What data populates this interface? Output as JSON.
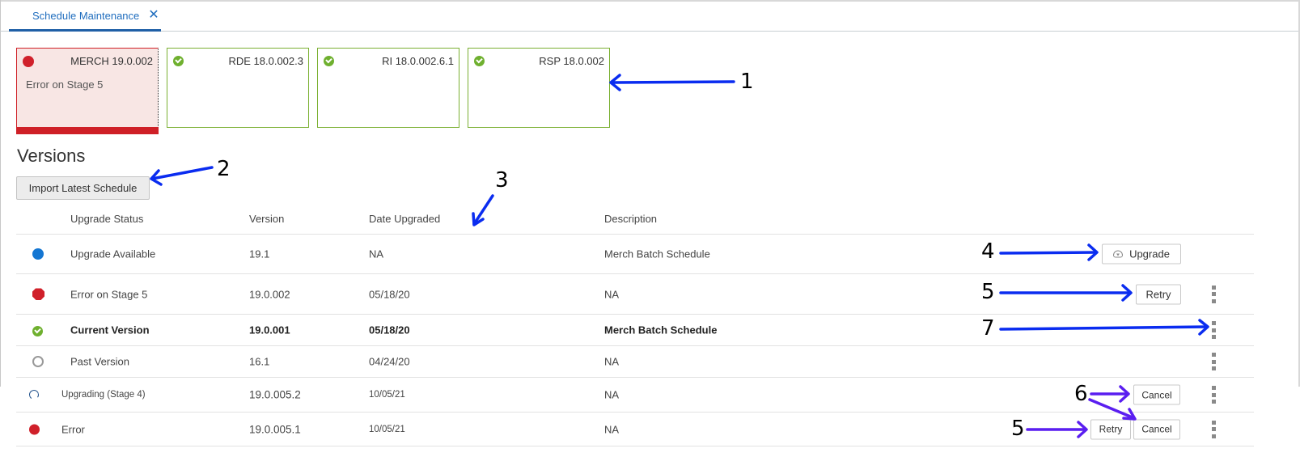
{
  "tab": {
    "label": "Schedule Maintenance",
    "close_icon": "close-icon"
  },
  "cards": [
    {
      "title": "MERCH 19.0.002",
      "status": "error",
      "status_text": "Error on Stage 5",
      "icon": "error-dot-icon",
      "color": "#cf2027"
    },
    {
      "title": "RDE 18.0.002.3",
      "status": "ok",
      "icon": "check-circle-icon",
      "color": "#7bb032"
    },
    {
      "title": "RI 18.0.002.6.1",
      "status": "ok",
      "icon": "check-circle-icon",
      "color": "#7bb032"
    },
    {
      "title": "RSP 18.0.002",
      "status": "ok",
      "icon": "check-circle-icon",
      "color": "#7bb032"
    }
  ],
  "versions": {
    "title": "Versions",
    "import_button": "Import Latest Schedule",
    "columns": [
      "Upgrade Status",
      "Version",
      "Date Upgraded",
      "Description"
    ],
    "rows": [
      {
        "icon": "blue-dot-icon",
        "status": "Upgrade Available",
        "version": "19.1",
        "date": "NA",
        "description": "Merch Batch Schedule",
        "actions": [
          "Upgrade"
        ],
        "menu": false
      },
      {
        "icon": "error-octagon-icon",
        "status": "Error on Stage 5",
        "version": "19.0.002",
        "date": "05/18/20",
        "description": "NA",
        "actions": [
          "Retry"
        ],
        "menu": true
      },
      {
        "icon": "check-circle-icon",
        "status": "Current Version",
        "version": "19.0.001",
        "date": "05/18/20",
        "description": "Merch Batch Schedule",
        "actions": [],
        "menu": true,
        "bold": true
      },
      {
        "icon": "empty-circle-icon",
        "status": "Past Version",
        "version": "16.1",
        "date": "04/24/20",
        "description": "NA",
        "actions": [],
        "menu": true
      },
      {
        "icon": "spinner-icon",
        "status": "Upgrading (Stage 4)",
        "version": "19.0.005.2",
        "date": "10/05/21",
        "description": "NA",
        "actions": [
          "Cancel"
        ],
        "menu": true
      },
      {
        "icon": "error-dot-icon",
        "status": "Error",
        "version": "19.0.005.1",
        "date": "10/05/21",
        "description": "NA",
        "actions": [
          "Retry",
          "Cancel"
        ],
        "menu": true
      }
    ]
  },
  "annotations": [
    "1",
    "2",
    "3",
    "4",
    "5",
    "7",
    "6",
    "5"
  ],
  "colors": {
    "accent": "#1f6dbe",
    "tab_underline": "#1f5fa6",
    "error": "#cf2027",
    "error_bg": "#f8e6e4",
    "success": "#7bb032",
    "info": "#1476d2",
    "annotation_arrow_blue": "#0a2cf0",
    "annotation_arrow_violet": "#5a1ef0"
  }
}
